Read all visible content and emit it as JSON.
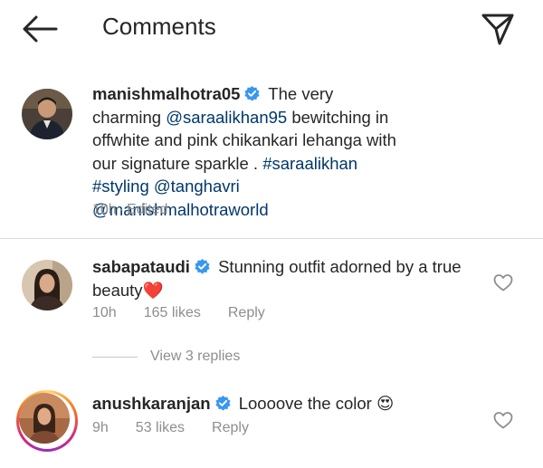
{
  "header": {
    "title": "Comments",
    "back_icon": "arrow-left-icon",
    "direct_icon": "paper-plane-icon"
  },
  "caption": {
    "username": "manishmalhotra05",
    "verified": true,
    "text_1": "The very charming",
    "mention_1": "@saraalikhan95",
    "text_2": "bewitching in offwhite and pink chikankari lehanga with our signature sparkle .",
    "hashtag_1": "#saraalikhan",
    "hashtag_2": "#styling",
    "mention_2": "@tanghavri",
    "mention_3": "@manishmalhotraworld",
    "time": "10h",
    "edited": "Edited",
    "separator": "·"
  },
  "comments": [
    {
      "username": "sabapataudi",
      "verified": true,
      "text": "Stunning outfit adorned by a true beauty",
      "emoji": "❤️",
      "time": "10h",
      "likes": "165 likes",
      "reply_label": "Reply",
      "view_replies": "View 3 replies"
    },
    {
      "username": "anushkaranjan",
      "verified": true,
      "text": "Loooove the color",
      "emoji": "😍",
      "time": "9h",
      "likes": "53 likes",
      "reply_label": "Reply"
    }
  ],
  "colors": {
    "text": "#262626",
    "secondary": "#8e8e8e",
    "link": "#00376b",
    "verified": "#3897f0",
    "heart": "#ed4956"
  }
}
